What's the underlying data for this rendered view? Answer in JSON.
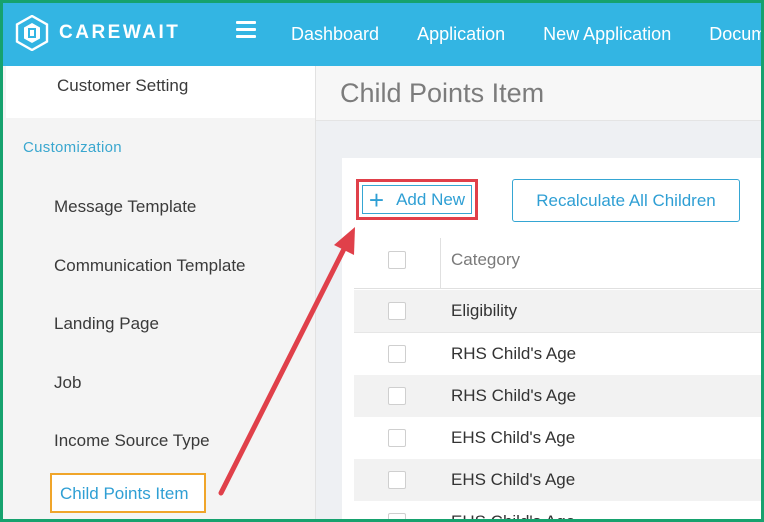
{
  "app": {
    "brand": "CAREWAIT"
  },
  "nav": {
    "items": [
      "Dashboard",
      "Application",
      "New Application",
      "Documents"
    ]
  },
  "sidebar": {
    "top_item": "Customer Setting",
    "section_label": "Customization",
    "items": [
      "Message Template",
      "Communication Template",
      "Landing Page",
      "Job",
      "Income Source Type"
    ],
    "active_item": "Child Points Item"
  },
  "page": {
    "title": "Child Points Item"
  },
  "toolbar": {
    "add_label": "Add New",
    "recalc_label": "Recalculate All Children"
  },
  "table": {
    "header_category": "Category",
    "rows": [
      {
        "category": "Eligibility"
      },
      {
        "category": "RHS Child's Age"
      },
      {
        "category": "RHS Child's Age"
      },
      {
        "category": "EHS Child's Age"
      },
      {
        "category": "EHS Child's Age"
      },
      {
        "category": "EHS Child's Age"
      }
    ]
  },
  "colors": {
    "header_bg": "#33b5e3",
    "accent": "#2f9fd4",
    "highlight_red": "#e0404a",
    "highlight_orange": "#f0a52a",
    "frame_green": "#16a26e"
  },
  "icons": {
    "logo": "carewait-logo-icon",
    "menu": "hamburger-icon",
    "add": "plus-icon",
    "annotation": "red-arrow-annotation"
  }
}
